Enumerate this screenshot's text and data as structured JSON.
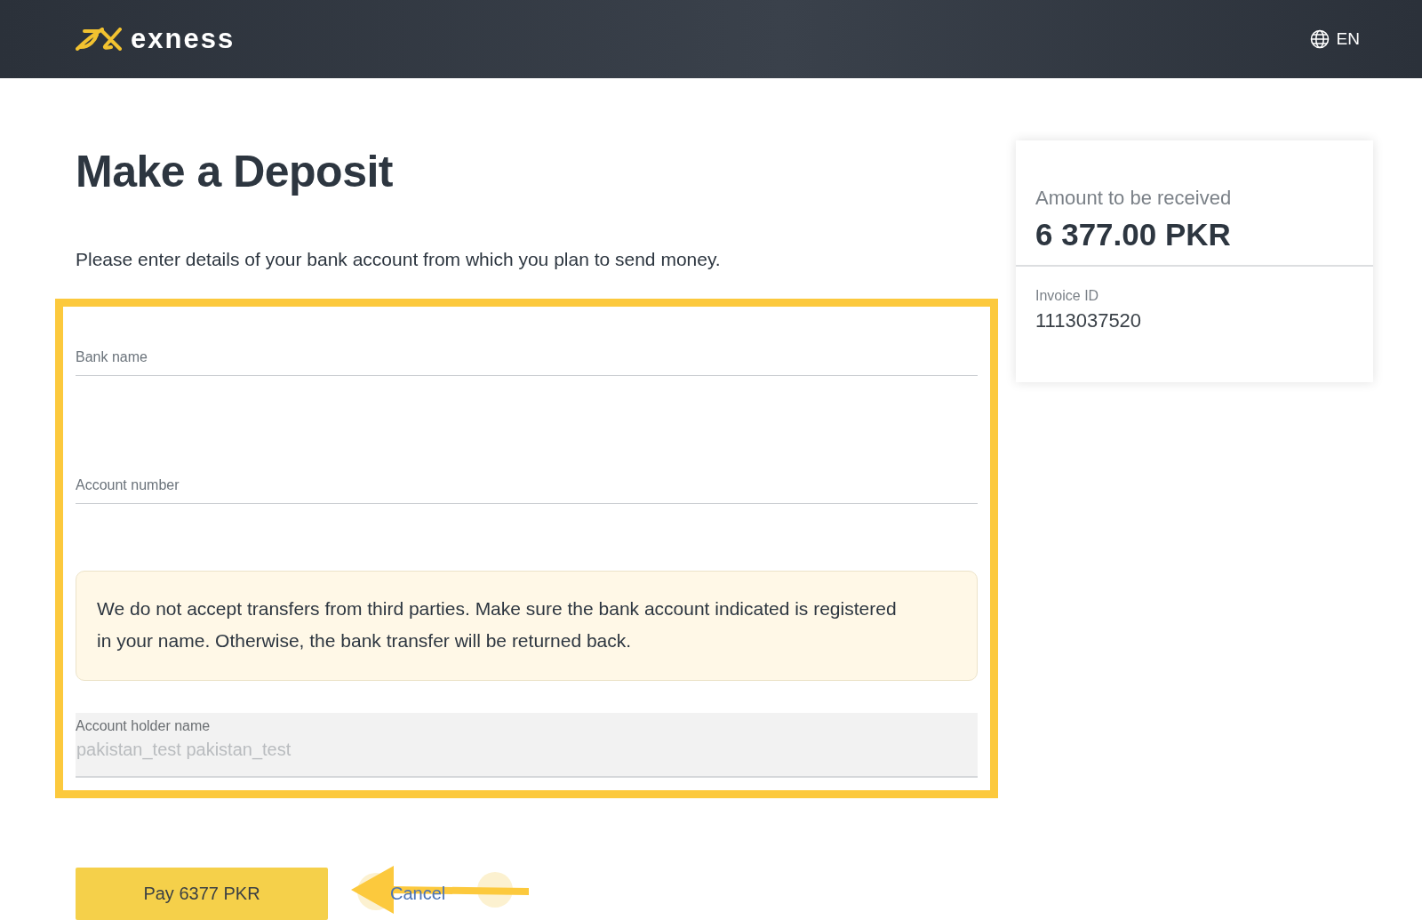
{
  "header": {
    "logo": "exness",
    "language": "EN"
  },
  "title": "Make a Deposit",
  "intro": "Please enter details of your bank account from which you plan to send money.",
  "form": [
    {
      "kind": "input",
      "label": "Bank name",
      "disabled": false
    },
    {
      "kind": "input",
      "label": "Account number",
      "disabled": false
    },
    {
      "kind": "notice",
      "text": "We do not accept transfers from third parties. Make sure the bank account indicated is registered in your name. Otherwise, the bank transfer will be returned back."
    },
    {
      "kind": "input",
      "label": "Account holder name",
      "value": "pakistan_test pakistan_test",
      "disabled": true
    }
  ],
  "summary": {
    "amount_label": "Amount to be received",
    "amount": "6 377.00 PKR",
    "invoice_label": "Invoice ID",
    "invoice_id": "1113037520"
  },
  "actions": {
    "pay": "Pay 6377 PKR",
    "cancel": "Cancel"
  }
}
